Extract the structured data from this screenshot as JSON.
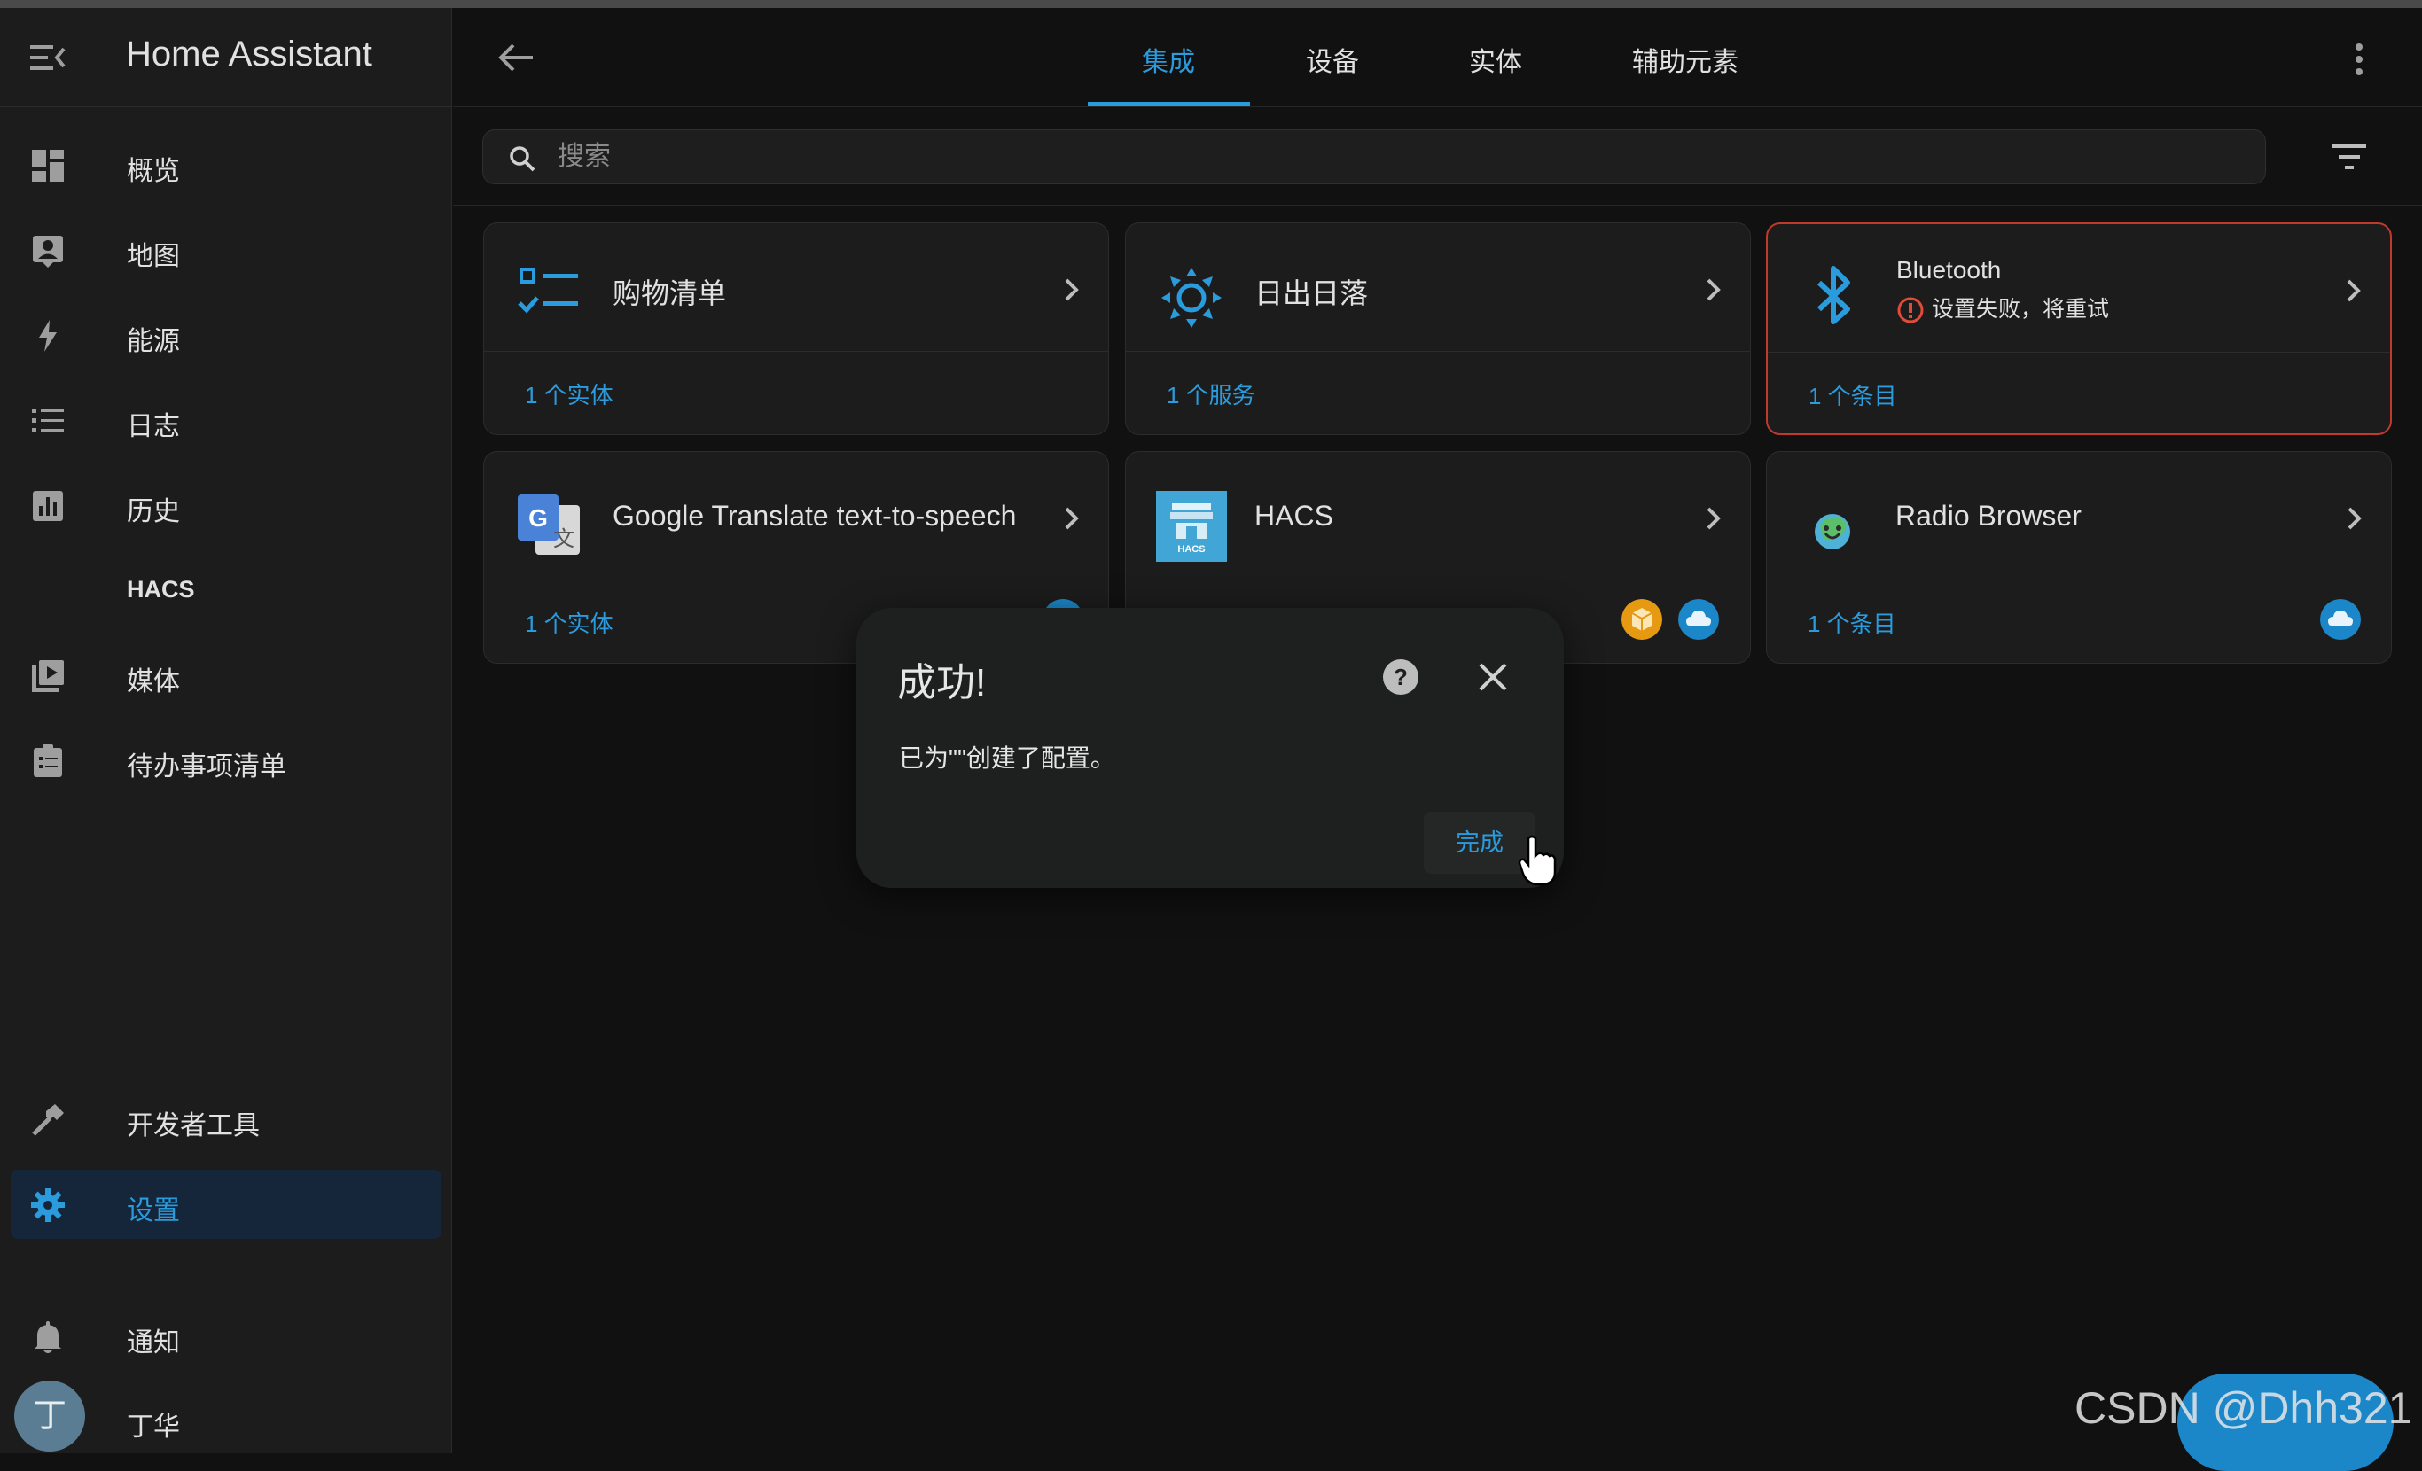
{
  "app": {
    "title": "Home Assistant"
  },
  "sidebar": {
    "items": [
      {
        "label": "概览",
        "icon": "dashboard-icon"
      },
      {
        "label": "地图",
        "icon": "map-person-icon"
      },
      {
        "label": "能源",
        "icon": "lightning-icon"
      },
      {
        "label": "日志",
        "icon": "list-icon"
      },
      {
        "label": "历史",
        "icon": "chart-box-icon"
      },
      {
        "label": "HACS",
        "icon": ""
      },
      {
        "label": "媒体",
        "icon": "play-box-icon"
      },
      {
        "label": "待办事项清单",
        "icon": "clipboard-list-icon"
      }
    ],
    "bottom_items": [
      {
        "label": "开发者工具",
        "icon": "hammer-icon"
      },
      {
        "label": "设置",
        "icon": "cog-icon",
        "active": true
      }
    ],
    "notifications_label": "通知",
    "user": {
      "initial": "丁",
      "name": "丁华"
    }
  },
  "tabs": [
    {
      "label": "集成",
      "active": true
    },
    {
      "label": "设备"
    },
    {
      "label": "实体"
    },
    {
      "label": "辅助元素"
    }
  ],
  "search": {
    "placeholder": "搜索"
  },
  "cards": [
    {
      "name": "购物清单",
      "footer": "1 个实体",
      "icon": "checklist-icon"
    },
    {
      "name": "日出日落",
      "footer": "1 个服务",
      "icon": "sun-icon"
    },
    {
      "name": "Bluetooth",
      "error": "设置失败，将重试",
      "footer": "1 个条目",
      "icon": "bluetooth-icon"
    },
    {
      "name": "Google Translate text-to-speech",
      "footer": "1 个实体",
      "icon": "google-translate-icon"
    },
    {
      "name": "HACS",
      "footer": "",
      "icon": "hacs-icon",
      "logo_text": "HACS"
    },
    {
      "name": "Radio Browser",
      "footer": "1 个条目",
      "icon": "radio-browser-icon"
    }
  ],
  "dialog": {
    "title": "成功!",
    "message": "已为\"\"创建了配置。",
    "done_label": "完成"
  },
  "watermark": "CSDN @Dhh321",
  "colors": {
    "accent": "#2a9bdc",
    "error": "#c0392b",
    "background": "#111111",
    "card": "#1c1c1c"
  }
}
